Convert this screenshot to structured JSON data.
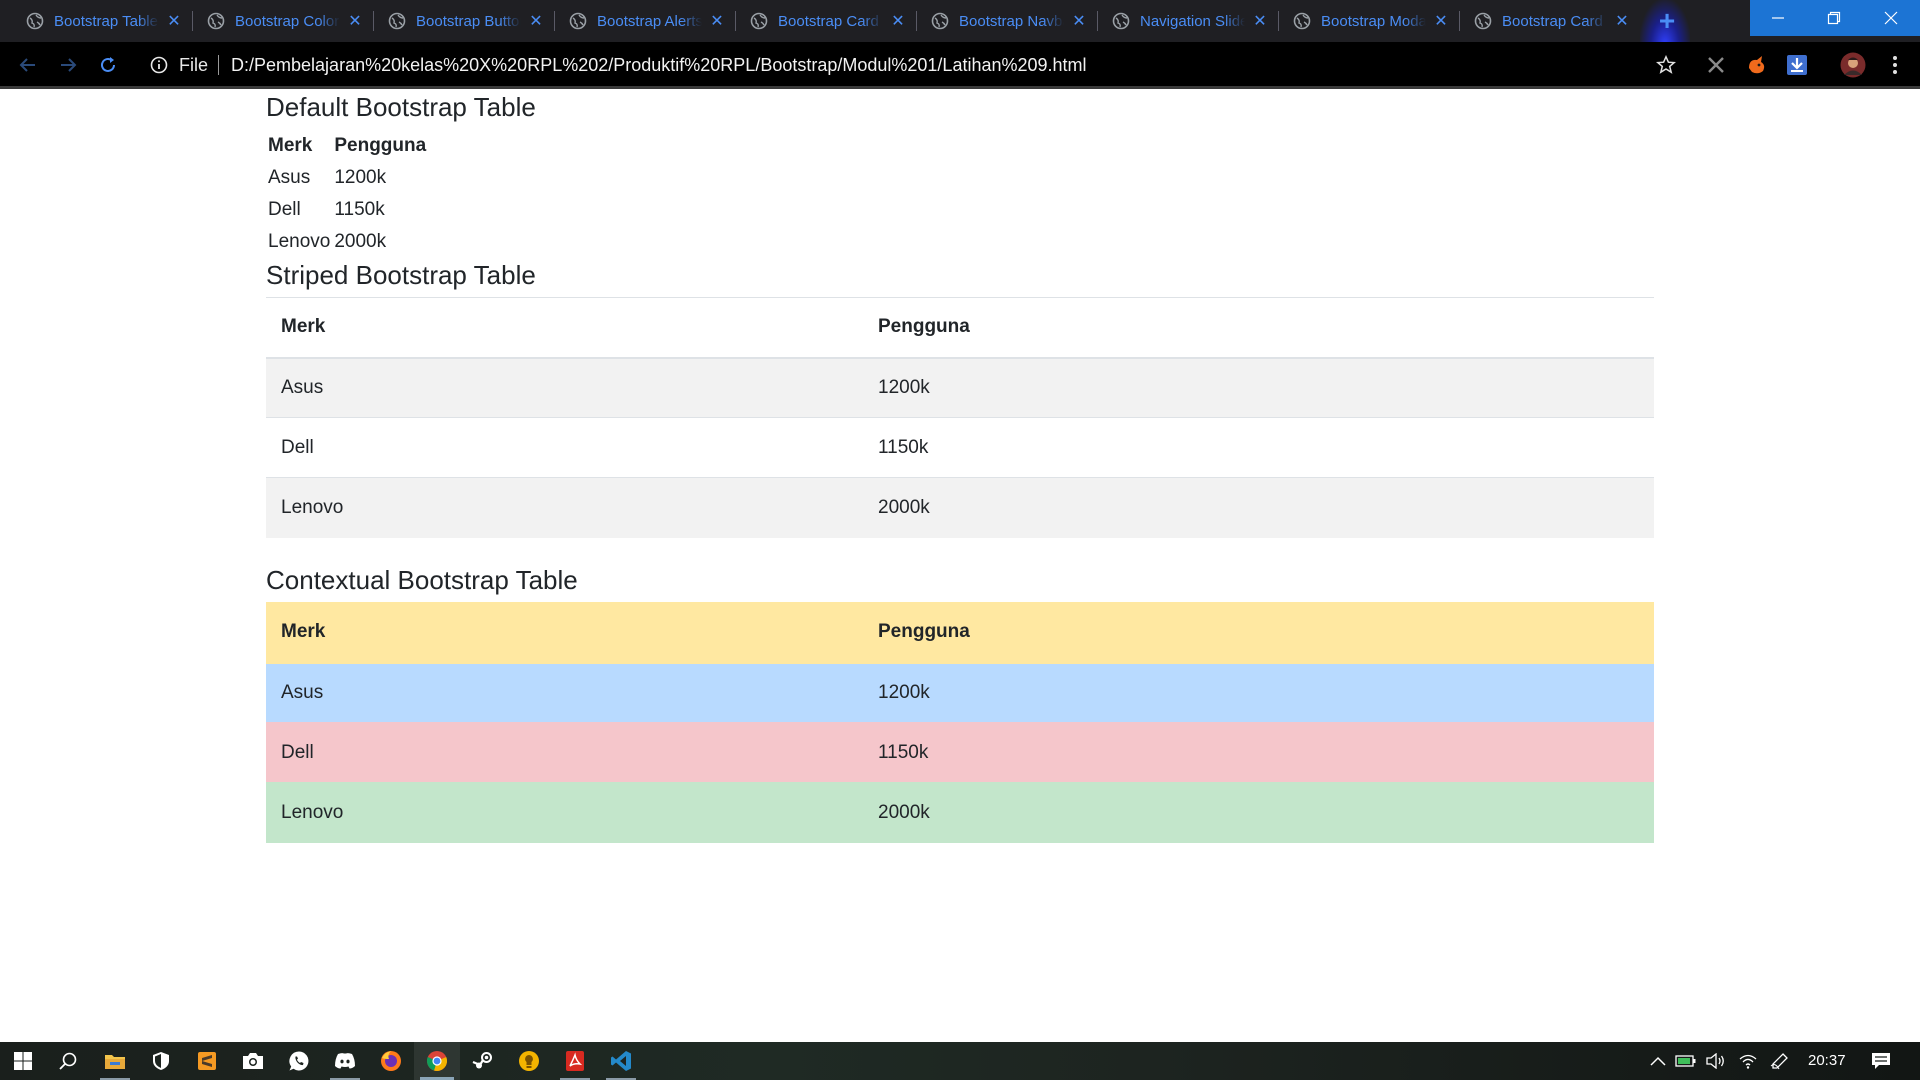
{
  "browser": {
    "tabs": [
      {
        "title": "Bootstrap Table"
      },
      {
        "title": "Bootstrap Colors"
      },
      {
        "title": "Bootstrap Buttons"
      },
      {
        "title": "Bootstrap Alerts"
      },
      {
        "title": "Bootstrap Card"
      },
      {
        "title": "Bootstrap Navbar"
      },
      {
        "title": "Navigation Slider"
      },
      {
        "title": "Bootstrap Modal"
      },
      {
        "title": "Bootstrap Card"
      }
    ],
    "address": {
      "scheme": "File",
      "url": "D:/Pembelajaran%20kelas%20X%20RPL%202/Produktif%20RPL/Bootstrap/Modul%201/Latihan%209.html"
    },
    "accent_color": "#4a8df5"
  },
  "page": {
    "default_table": {
      "heading": "Default Bootstrap Table",
      "headers": [
        "Merk",
        "Pengguna"
      ],
      "rows": [
        [
          "Asus",
          "1200k"
        ],
        [
          "Dell",
          "1150k"
        ],
        [
          "Lenovo",
          "2000k"
        ]
      ]
    },
    "striped_table": {
      "heading": "Striped Bootstrap Table",
      "headers": [
        "Merk",
        "Pengguna"
      ],
      "rows": [
        [
          "Asus",
          "1200k"
        ],
        [
          "Dell",
          "1150k"
        ],
        [
          "Lenovo",
          "2000k"
        ]
      ]
    },
    "contextual_table": {
      "heading": "Contextual Bootstrap Table",
      "headers": [
        "Merk",
        "Pengguna"
      ],
      "rows": [
        [
          "Asus",
          "1200k"
        ],
        [
          "Dell",
          "1150k"
        ],
        [
          "Lenovo",
          "2000k"
        ]
      ],
      "colors": {
        "header": "#ffe8a1",
        "info": "#b8daff",
        "danger": "#f5c6cb",
        "success": "#c3e6cb"
      }
    }
  },
  "taskbar": {
    "apps": [
      "start-icon",
      "search-icon",
      "file-explorer-icon",
      "security-icon",
      "sublime-text-icon",
      "camera-icon",
      "whatsapp-icon",
      "discord-icon",
      "firefox-icon",
      "chrome-icon",
      "steam-icon",
      "app-bulb-icon",
      "acrobat-icon",
      "vscode-icon"
    ],
    "clock": "20:37"
  }
}
